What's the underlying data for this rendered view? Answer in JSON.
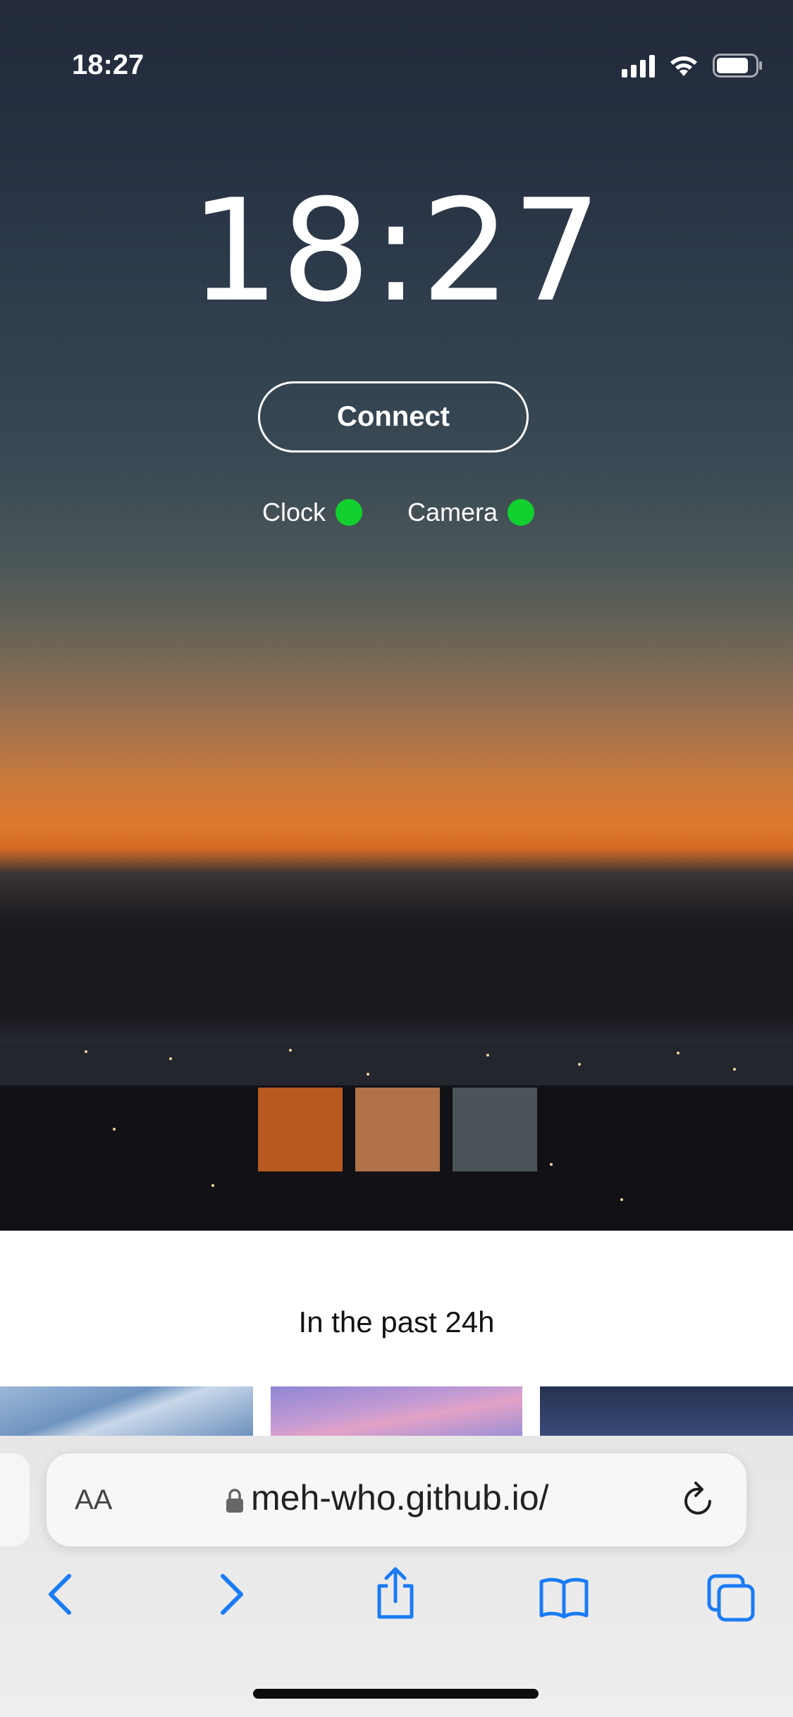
{
  "status_bar": {
    "time": "18:27"
  },
  "clock": {
    "time": "18:27"
  },
  "connect_button": {
    "label": "Connect"
  },
  "indicators": [
    {
      "label": "Clock",
      "color": "#12d12e"
    },
    {
      "label": "Camera",
      "color": "#12d12e"
    }
  ],
  "palette": [
    "#b65a21",
    "#b1724a",
    "#4a5459"
  ],
  "history": {
    "label": "In the past 24h"
  },
  "browser": {
    "text_size_label": "AA",
    "url": "meh-who.github.io/",
    "accent": "#1a7cf5"
  }
}
